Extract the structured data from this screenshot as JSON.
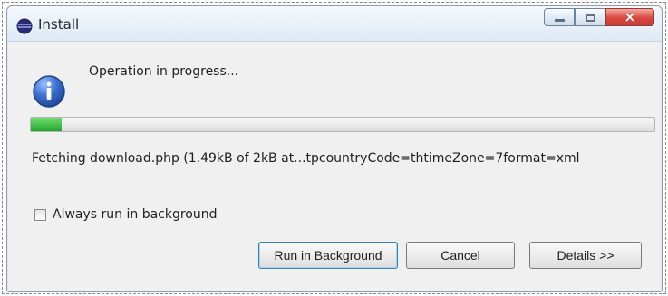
{
  "window": {
    "title": "Install",
    "controls": {
      "minimize_icon": "minimize-icon",
      "maximize_icon": "maximize-icon",
      "close_icon": "close-icon"
    }
  },
  "message": {
    "icon": "info-icon",
    "text": "Operation in progress..."
  },
  "progress": {
    "value_percent": 5
  },
  "status": {
    "text": "Fetching download.php (1.49kB of 2kB at...tpcountryCode=thtimeZone=7format=xml"
  },
  "options": {
    "always_run_background_label": "Always run in background",
    "always_run_background_checked": false
  },
  "buttons": {
    "run_background": "Run in Background",
    "cancel": "Cancel",
    "details": "Details >>"
  },
  "colors": {
    "progress_fill": "#2aa63a",
    "close_button": "#d9473f",
    "info_icon": "#2d5fbf"
  }
}
